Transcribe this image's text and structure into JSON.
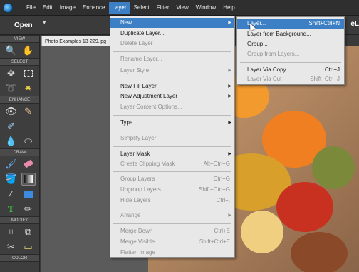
{
  "menubar": {
    "items": [
      {
        "id": "file",
        "label": "File"
      },
      {
        "id": "edit",
        "label": "Edit"
      },
      {
        "id": "image",
        "label": "Image"
      },
      {
        "id": "enhance",
        "label": "Enhance"
      },
      {
        "id": "layer",
        "label": "Layer"
      },
      {
        "id": "select",
        "label": "Select"
      },
      {
        "id": "filter",
        "label": "Filter"
      },
      {
        "id": "view",
        "label": "View"
      },
      {
        "id": "window",
        "label": "Window"
      },
      {
        "id": "help",
        "label": "Help"
      }
    ],
    "active": "Layer"
  },
  "options": {
    "open_label": "Open",
    "open_caret": "▾",
    "right_fragment": "eL"
  },
  "toolbox": {
    "sections": {
      "view": "VIEW",
      "select": "SELECT",
      "enhance": "ENHANCE",
      "draw": "DRAW",
      "modify": "MODIFY",
      "color": "COLOR"
    }
  },
  "document": {
    "tab_title": "Photo Examples 13-229.jpg"
  },
  "layer_menu": {
    "items": [
      {
        "label": "New",
        "arrow": "▶",
        "state": "highlighted"
      },
      {
        "label": "Duplicate Layer...",
        "state": "enabled"
      },
      {
        "label": "Delete Layer",
        "state": "disabled"
      },
      {
        "label": "Rename Layer...",
        "state": "disabled"
      },
      {
        "label": "Layer Style",
        "arrow": "▶",
        "state": "disabled"
      },
      {
        "label": "New Fill Layer",
        "arrow": "▶",
        "state": "enabled"
      },
      {
        "label": "New Adjustment Layer",
        "arrow": "▶",
        "state": "enabled"
      },
      {
        "label": "Layer Content Options...",
        "state": "disabled"
      },
      {
        "label": "Type",
        "arrow": "▶",
        "state": "enabled"
      },
      {
        "label": "Simplify Layer",
        "state": "disabled"
      },
      {
        "label": "Layer Mask",
        "arrow": "▶",
        "state": "enabled"
      },
      {
        "label": "Create Clipping Mask",
        "shortcut": "Alt+Ctrl+G",
        "state": "disabled"
      },
      {
        "label": "Group Layers",
        "shortcut": "Ctrl+G",
        "state": "disabled"
      },
      {
        "label": "Ungroup Layers",
        "shortcut": "Shift+Ctrl+G",
        "state": "disabled"
      },
      {
        "label": "Hide Layers",
        "shortcut": "Ctrl+,",
        "state": "disabled"
      },
      {
        "label": "Arrange",
        "arrow": "▶",
        "state": "disabled"
      },
      {
        "label": "Merge Down",
        "shortcut": "Ctrl+E",
        "state": "disabled"
      },
      {
        "label": "Merge Visible",
        "shortcut": "Shift+Ctrl+E",
        "state": "disabled"
      },
      {
        "label": "Flatten Image",
        "state": "disabled"
      }
    ]
  },
  "new_submenu": {
    "items": [
      {
        "label": "Layer...",
        "shortcut": "Shift+Ctrl+N",
        "state": "highlighted"
      },
      {
        "label": "Layer from Background...",
        "state": "enabled"
      },
      {
        "label": "Group...",
        "state": "enabled"
      },
      {
        "label": "Group from Layers...",
        "state": "disabled"
      },
      {
        "label": "Layer Via Copy",
        "shortcut": "Ctrl+J",
        "state": "enabled"
      },
      {
        "label": "Layer Via Cut",
        "shortcut": "Shift+Ctrl+J",
        "state": "disabled"
      }
    ]
  },
  "colors": {
    "menu_highlight": "#3c7fc4",
    "menu_bg": "#e8e8e8",
    "disabled_text": "#8f8f8f",
    "app_dark": "#2f2f2f"
  }
}
